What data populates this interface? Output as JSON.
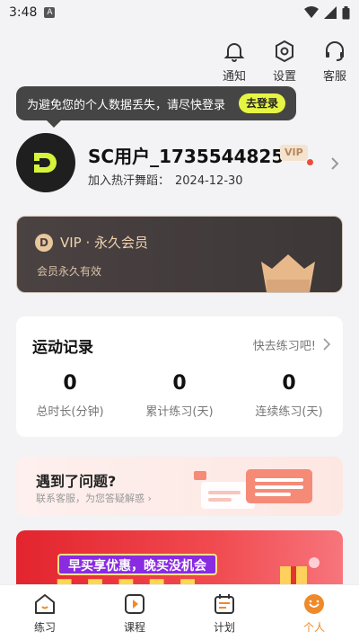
{
  "status": {
    "time": "3:48",
    "notif_badge": "A"
  },
  "top_actions": [
    {
      "label": "通知"
    },
    {
      "label": "设置"
    },
    {
      "label": "客服"
    }
  ],
  "tooltip": {
    "text": "为避免您的个人数据丢失，请尽快登录",
    "button": "去登录"
  },
  "profile": {
    "username": "SC用户_1735544825",
    "vip_badge": "VIP",
    "joined_label": "加入热汗舞蹈：",
    "joined_date": "2024-12-30"
  },
  "vip_card": {
    "title": "VIP · 永久会员",
    "subtitle": "会员永久有效"
  },
  "stats": {
    "title": "运动记录",
    "action": "快去练习吧!",
    "items": [
      {
        "value": "0",
        "label": "总时长(分钟)"
      },
      {
        "value": "0",
        "label": "累计练习(天)"
      },
      {
        "value": "0",
        "label": "连续练习(天)"
      }
    ]
  },
  "help": {
    "title": "遇到了问题?",
    "subtitle": "联系客服，为您答疑解惑 ›"
  },
  "promo": {
    "tag": "早买享优惠，晚买没机会"
  },
  "tabs": [
    {
      "label": "练习"
    },
    {
      "label": "课程"
    },
    {
      "label": "计划"
    },
    {
      "label": "个人"
    }
  ],
  "colors": {
    "accent": "#f0892a",
    "vip_gold": "#f0d3b0",
    "login_btn": "#e6f542"
  }
}
